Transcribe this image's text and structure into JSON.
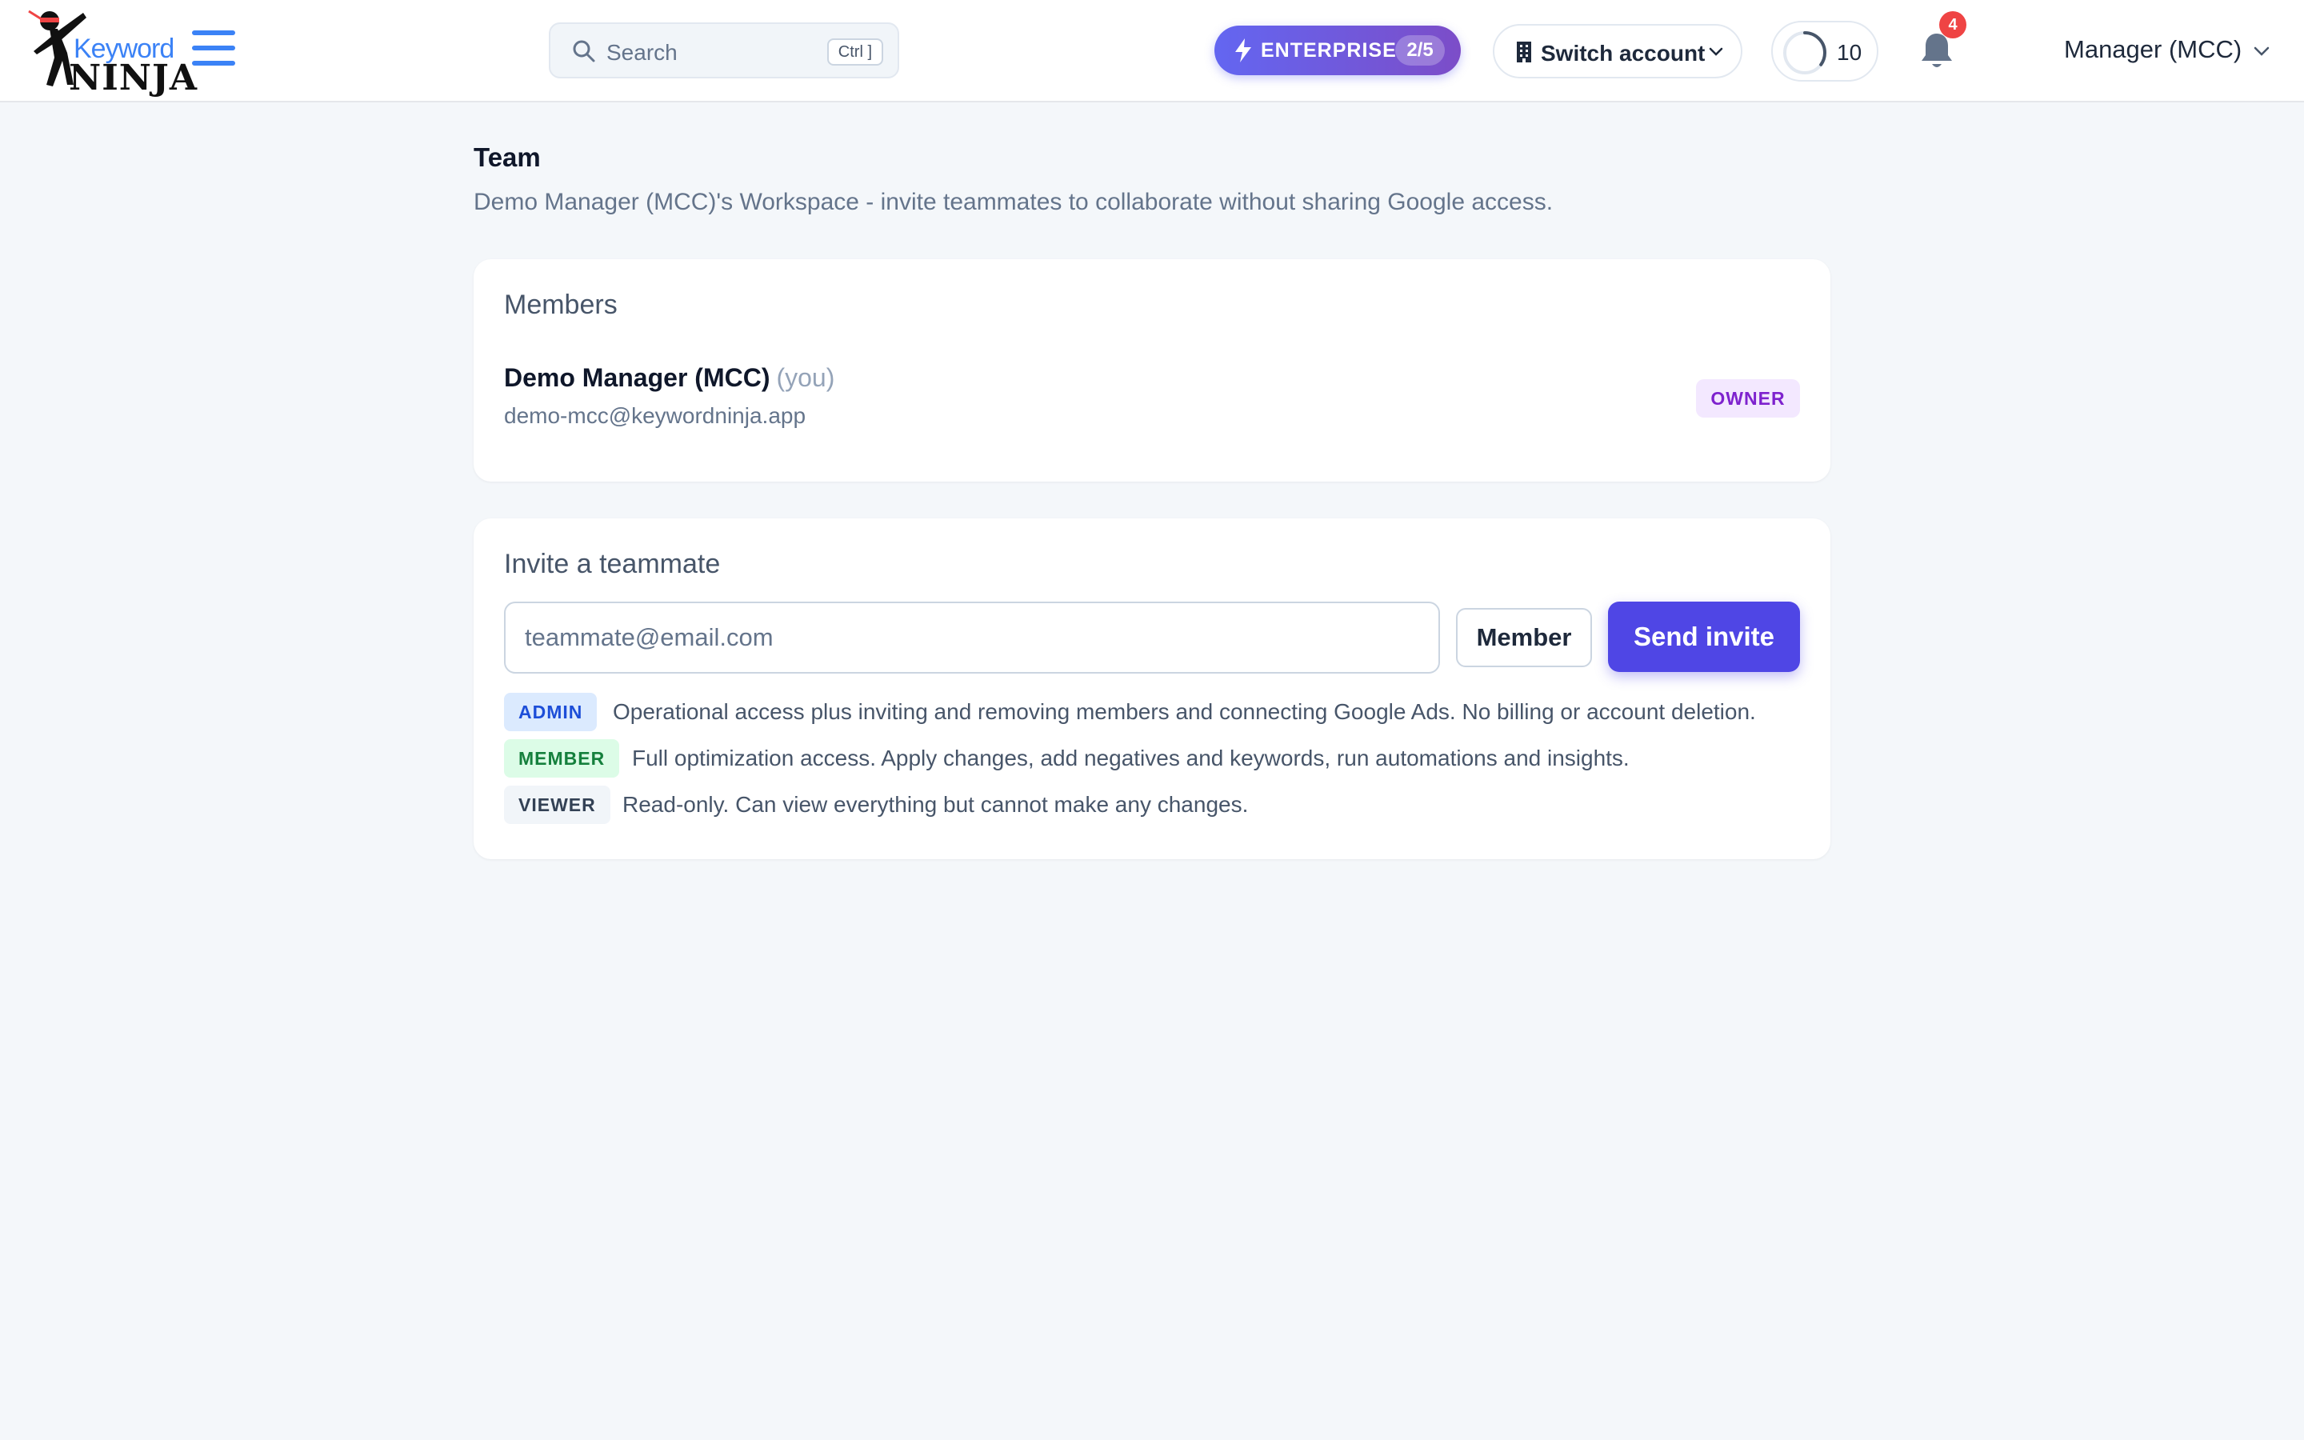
{
  "header": {
    "logo": {
      "word_top": "Keyword",
      "word_bottom": "NINJA"
    },
    "search": {
      "placeholder": "Search",
      "shortcut": "Ctrl ]"
    },
    "plan": {
      "label": "ENTERPRISE",
      "count": "2/5"
    },
    "switch_account": {
      "label": "Switch account"
    },
    "credits": {
      "value": "10",
      "progress": 0.35
    },
    "notifications": {
      "count": "4"
    },
    "user_menu": {
      "label": "Manager (MCC)"
    }
  },
  "page": {
    "title": "Team",
    "subtitle": "Demo Manager (MCC)'s Workspace - invite teammates to collaborate without sharing Google access."
  },
  "members": {
    "title": "Members",
    "list": [
      {
        "name": "Demo Manager (MCC)",
        "you": "(you)",
        "email": "demo-mcc@keywordninja.app",
        "role": "OWNER"
      }
    ]
  },
  "invite": {
    "title": "Invite a teammate",
    "email_placeholder": "teammate@email.com",
    "email_value": "",
    "role_selected": "Member",
    "send_label": "Send invite",
    "roles": [
      {
        "badge": "ADMIN",
        "description": "Operational access plus inviting and removing members and connecting Google Ads. No billing or account deletion."
      },
      {
        "badge": "MEMBER",
        "description": "Full optimization access. Apply changes, add negatives and keywords, run automations and insights."
      },
      {
        "badge": "VIEWER",
        "description": "Read-only. Can view everything but cannot make any changes."
      }
    ]
  },
  "colors": {
    "accent": "#4f46e5",
    "hamburger": "#3b82f6",
    "notification_badge": "#ef4444",
    "owner_badge_bg": "#f3e8ff",
    "owner_badge_text": "#7e22ce"
  },
  "icons": [
    "ninja-logo",
    "menu-icon",
    "search-icon",
    "lightning-icon",
    "building-icon",
    "chevron-down-icon",
    "progress-ring-icon",
    "bell-icon"
  ]
}
